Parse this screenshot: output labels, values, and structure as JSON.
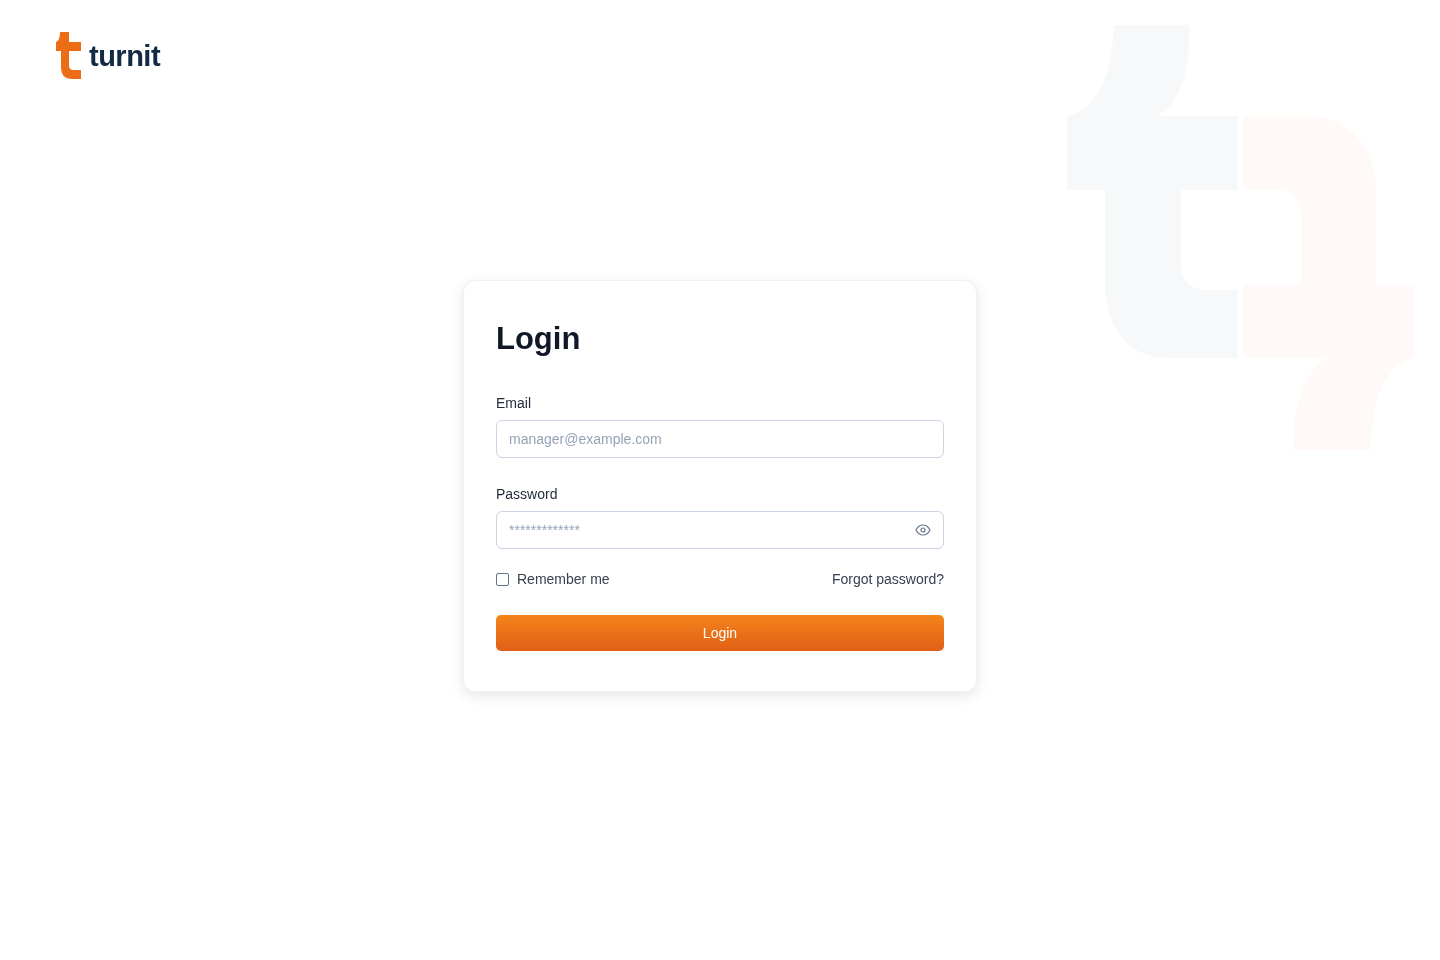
{
  "brand": {
    "name": "turnit"
  },
  "form": {
    "title": "Login",
    "email": {
      "label": "Email",
      "placeholder": "manager@example.com"
    },
    "password": {
      "label": "Password",
      "placeholder": "*************"
    },
    "remember": {
      "label": "Remember me",
      "checked": false
    },
    "forgot_link": "Forgot password?",
    "submit": "Login"
  }
}
